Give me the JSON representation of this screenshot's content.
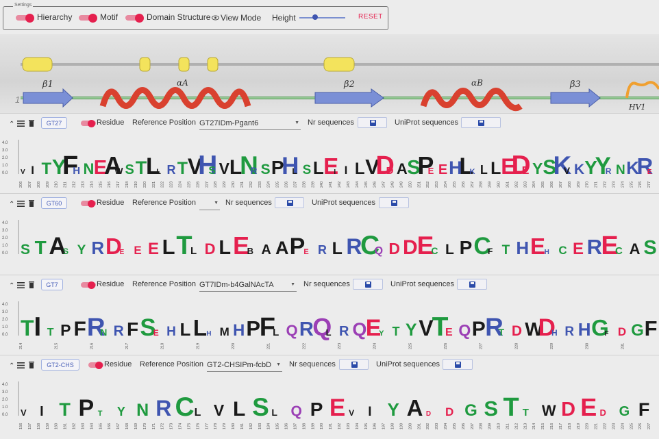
{
  "settings": {
    "legend": "Settings",
    "toggles": [
      {
        "label": "Hierarchy",
        "on": true
      },
      {
        "label": "Motif",
        "on": true
      },
      {
        "label": "Domain Structure",
        "on": true
      }
    ],
    "view_mode_label": "View Mode",
    "height_label": "Height",
    "height_level_fraction": 0.35,
    "reset_label": "RESET"
  },
  "structure": {
    "start_label": "1",
    "elements": [
      "β1",
      "αA",
      "β2",
      "αB",
      "β3",
      "HV1"
    ]
  },
  "colors": {
    "accent": "#e5204e",
    "strand": "#7a8fd6",
    "helix": "#d9412f",
    "loop_green": "#4f9a4f",
    "hv_orange": "#f0a030",
    "motif_yellow": "#f3e35c"
  },
  "panels": [
    {
      "family": "GT27",
      "residue_label": "Residue",
      "ref_label": "Reference Position",
      "ref_value": "GT27IDm-Pgant6",
      "nr_label": "Nr sequences",
      "uniprot_label": "UniProt sequences",
      "logo": "VITYFHNEAWSTLLRTVHSVLNRSPHLSLEIILVDDASPEEHLKLLEDEYSKVKYYRNKRE",
      "ticks": [
        "206",
        "207",
        "208",
        "209",
        "210",
        "211",
        "212",
        "213",
        "214",
        "215",
        "216",
        "217",
        "218",
        "219",
        "220",
        "221",
        "222",
        "223",
        "224",
        "225",
        "226",
        "227",
        "228",
        "229",
        "230",
        "231",
        "232",
        "233",
        "234",
        "235",
        "236",
        "237",
        "238",
        "239",
        "240",
        "241",
        "242",
        "243",
        "244",
        "245",
        "246",
        "247",
        "248",
        "249",
        "250",
        "251",
        "252",
        "253",
        "254",
        "255",
        "256",
        "257",
        "258",
        "259",
        "260",
        "261",
        "262",
        "263",
        "264",
        "265",
        "266",
        "267",
        "268",
        "269",
        "270",
        "271",
        "272",
        "273",
        "274",
        "275",
        "276",
        "277"
      ]
    },
    {
      "family": "GT60",
      "residue_label": "Residue",
      "ref_label": "Reference Position",
      "ref_value": "",
      "nr_label": "Nr sequences",
      "uniprot_label": "UniProt sequences",
      "logo": "STASYRDEEELTLDLEBAAPERLRCQDDECLPCFTHEHCERECAS",
      "ticks": []
    },
    {
      "family": "GT7",
      "residue_label": "Residue",
      "ref_label": "Reference Position",
      "ref_value": "GT7IDm-b4GalNAcTA",
      "nr_label": "Nr sequences",
      "uniprot_label": "UniProt sequences",
      "logo": "TITPFRNRFSEHLLHMHPFLQRQLRQEYTYVTEQPRTDWDHRHGFDGF",
      "ticks": [
        "214",
        "215",
        "216",
        "217",
        "218",
        "219",
        "220",
        "221",
        "222",
        "223",
        "224",
        "225",
        "226",
        "227",
        "228",
        "229",
        "230",
        "231"
      ]
    },
    {
      "family": "GT2-CHS",
      "residue_label": "Residue",
      "ref_label": "Reference Position",
      "ref_value": "GT2-CHSIPm-fcbD",
      "nr_label": "Nr sequences",
      "uniprot_label": "UniProt sequences",
      "logo": "VITPTYNRCLVLSLQPEVIYADDGSTTWDEDGF",
      "ticks": [
        "156",
        "157",
        "158",
        "159",
        "160",
        "161",
        "162",
        "163",
        "164",
        "165",
        "166",
        "167",
        "168",
        "169",
        "170",
        "171",
        "172",
        "173",
        "174",
        "175",
        "176",
        "177",
        "178",
        "179",
        "180",
        "181",
        "182",
        "183",
        "184",
        "185",
        "186",
        "187",
        "188",
        "189",
        "190",
        "191",
        "192",
        "193",
        "194",
        "195",
        "196",
        "197",
        "198",
        "199",
        "200",
        "201",
        "202",
        "203",
        "204",
        "205",
        "206",
        "207",
        "208",
        "209",
        "210",
        "211",
        "212",
        "213",
        "214",
        "215",
        "216",
        "217",
        "218",
        "219",
        "220",
        "221",
        "222",
        "223",
        "224",
        "225",
        "226",
        "227"
      ]
    }
  ],
  "y_axis_labels": [
    "4.0",
    "3.0",
    "2.0",
    "1.0",
    "0.0"
  ]
}
